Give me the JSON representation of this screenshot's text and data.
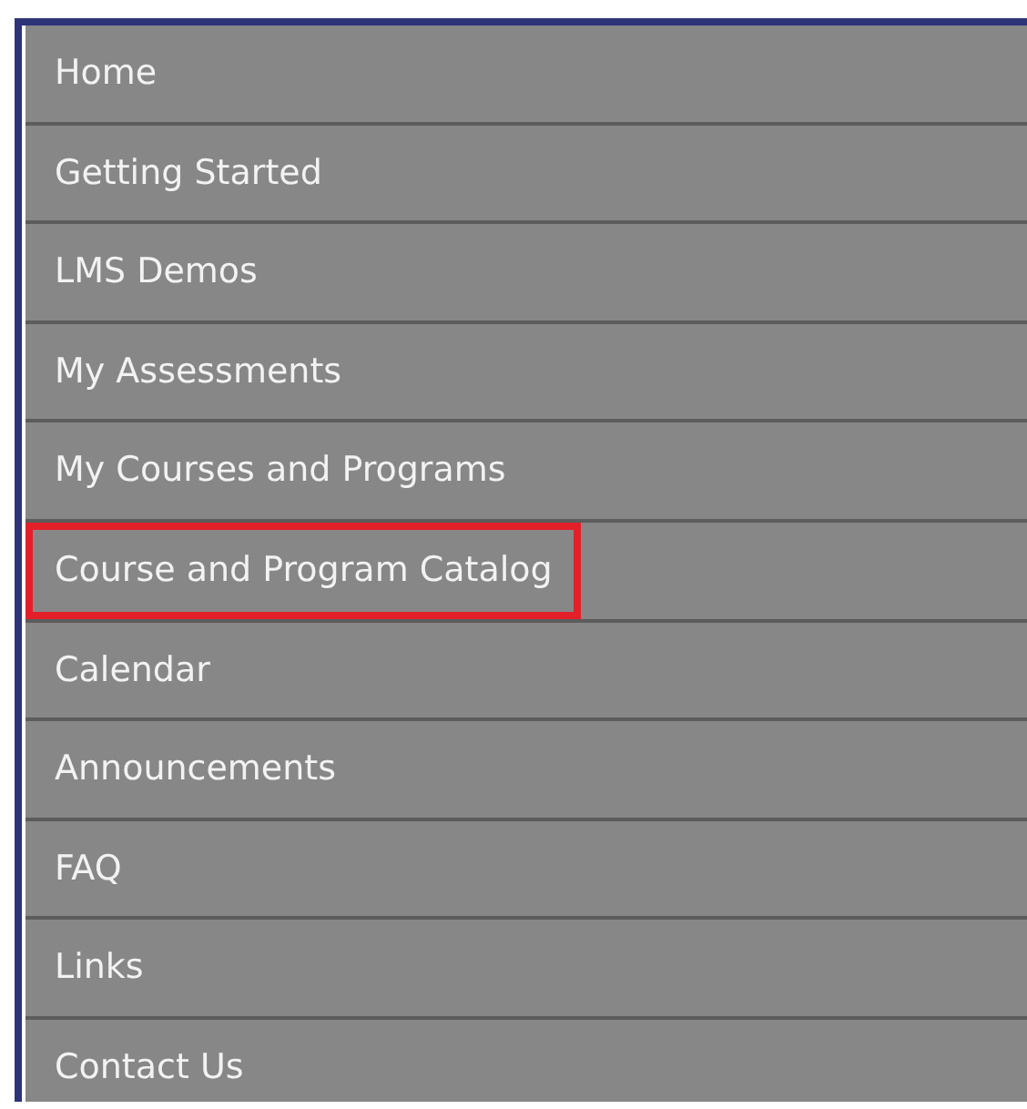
{
  "menu": {
    "items": [
      {
        "label": "Home",
        "highlighted": false
      },
      {
        "label": "Getting Started",
        "highlighted": false
      },
      {
        "label": "LMS Demos",
        "highlighted": false
      },
      {
        "label": "My Assessments",
        "highlighted": false
      },
      {
        "label": "My Courses and Programs",
        "highlighted": false
      },
      {
        "label": "Course and Program Catalog",
        "highlighted": true
      },
      {
        "label": "Calendar",
        "highlighted": false
      },
      {
        "label": "Announcements",
        "highlighted": false
      },
      {
        "label": "FAQ",
        "highlighted": false
      },
      {
        "label": "Links",
        "highlighted": false
      },
      {
        "label": "Contact Us",
        "highlighted": false
      }
    ]
  }
}
